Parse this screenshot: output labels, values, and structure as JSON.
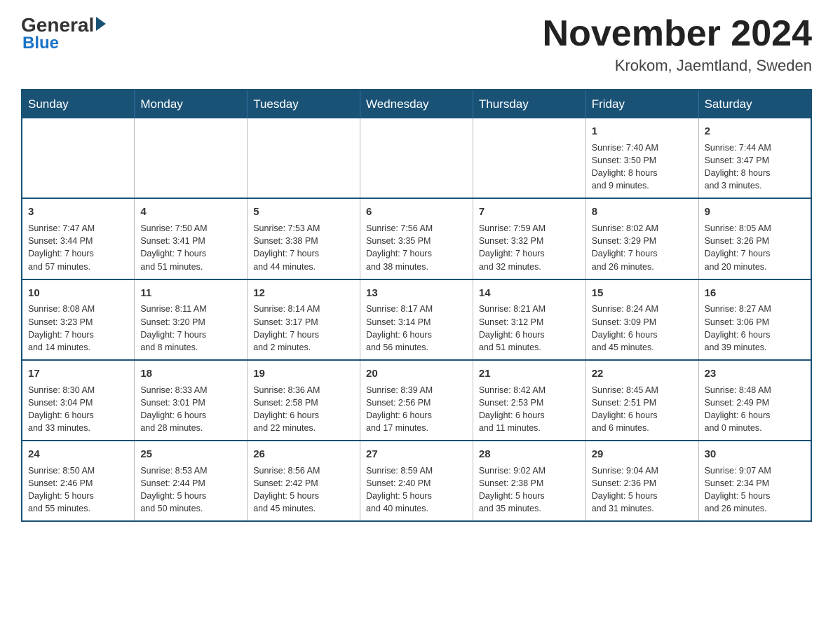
{
  "header": {
    "logo_general": "General",
    "logo_blue": "Blue",
    "month_title": "November 2024",
    "location": "Krokom, Jaemtland, Sweden"
  },
  "days_of_week": [
    "Sunday",
    "Monday",
    "Tuesday",
    "Wednesday",
    "Thursday",
    "Friday",
    "Saturday"
  ],
  "weeks": [
    [
      {
        "day": "",
        "info": ""
      },
      {
        "day": "",
        "info": ""
      },
      {
        "day": "",
        "info": ""
      },
      {
        "day": "",
        "info": ""
      },
      {
        "day": "",
        "info": ""
      },
      {
        "day": "1",
        "info": "Sunrise: 7:40 AM\nSunset: 3:50 PM\nDaylight: 8 hours\nand 9 minutes."
      },
      {
        "day": "2",
        "info": "Sunrise: 7:44 AM\nSunset: 3:47 PM\nDaylight: 8 hours\nand 3 minutes."
      }
    ],
    [
      {
        "day": "3",
        "info": "Sunrise: 7:47 AM\nSunset: 3:44 PM\nDaylight: 7 hours\nand 57 minutes."
      },
      {
        "day": "4",
        "info": "Sunrise: 7:50 AM\nSunset: 3:41 PM\nDaylight: 7 hours\nand 51 minutes."
      },
      {
        "day": "5",
        "info": "Sunrise: 7:53 AM\nSunset: 3:38 PM\nDaylight: 7 hours\nand 44 minutes."
      },
      {
        "day": "6",
        "info": "Sunrise: 7:56 AM\nSunset: 3:35 PM\nDaylight: 7 hours\nand 38 minutes."
      },
      {
        "day": "7",
        "info": "Sunrise: 7:59 AM\nSunset: 3:32 PM\nDaylight: 7 hours\nand 32 minutes."
      },
      {
        "day": "8",
        "info": "Sunrise: 8:02 AM\nSunset: 3:29 PM\nDaylight: 7 hours\nand 26 minutes."
      },
      {
        "day": "9",
        "info": "Sunrise: 8:05 AM\nSunset: 3:26 PM\nDaylight: 7 hours\nand 20 minutes."
      }
    ],
    [
      {
        "day": "10",
        "info": "Sunrise: 8:08 AM\nSunset: 3:23 PM\nDaylight: 7 hours\nand 14 minutes."
      },
      {
        "day": "11",
        "info": "Sunrise: 8:11 AM\nSunset: 3:20 PM\nDaylight: 7 hours\nand 8 minutes."
      },
      {
        "day": "12",
        "info": "Sunrise: 8:14 AM\nSunset: 3:17 PM\nDaylight: 7 hours\nand 2 minutes."
      },
      {
        "day": "13",
        "info": "Sunrise: 8:17 AM\nSunset: 3:14 PM\nDaylight: 6 hours\nand 56 minutes."
      },
      {
        "day": "14",
        "info": "Sunrise: 8:21 AM\nSunset: 3:12 PM\nDaylight: 6 hours\nand 51 minutes."
      },
      {
        "day": "15",
        "info": "Sunrise: 8:24 AM\nSunset: 3:09 PM\nDaylight: 6 hours\nand 45 minutes."
      },
      {
        "day": "16",
        "info": "Sunrise: 8:27 AM\nSunset: 3:06 PM\nDaylight: 6 hours\nand 39 minutes."
      }
    ],
    [
      {
        "day": "17",
        "info": "Sunrise: 8:30 AM\nSunset: 3:04 PM\nDaylight: 6 hours\nand 33 minutes."
      },
      {
        "day": "18",
        "info": "Sunrise: 8:33 AM\nSunset: 3:01 PM\nDaylight: 6 hours\nand 28 minutes."
      },
      {
        "day": "19",
        "info": "Sunrise: 8:36 AM\nSunset: 2:58 PM\nDaylight: 6 hours\nand 22 minutes."
      },
      {
        "day": "20",
        "info": "Sunrise: 8:39 AM\nSunset: 2:56 PM\nDaylight: 6 hours\nand 17 minutes."
      },
      {
        "day": "21",
        "info": "Sunrise: 8:42 AM\nSunset: 2:53 PM\nDaylight: 6 hours\nand 11 minutes."
      },
      {
        "day": "22",
        "info": "Sunrise: 8:45 AM\nSunset: 2:51 PM\nDaylight: 6 hours\nand 6 minutes."
      },
      {
        "day": "23",
        "info": "Sunrise: 8:48 AM\nSunset: 2:49 PM\nDaylight: 6 hours\nand 0 minutes."
      }
    ],
    [
      {
        "day": "24",
        "info": "Sunrise: 8:50 AM\nSunset: 2:46 PM\nDaylight: 5 hours\nand 55 minutes."
      },
      {
        "day": "25",
        "info": "Sunrise: 8:53 AM\nSunset: 2:44 PM\nDaylight: 5 hours\nand 50 minutes."
      },
      {
        "day": "26",
        "info": "Sunrise: 8:56 AM\nSunset: 2:42 PM\nDaylight: 5 hours\nand 45 minutes."
      },
      {
        "day": "27",
        "info": "Sunrise: 8:59 AM\nSunset: 2:40 PM\nDaylight: 5 hours\nand 40 minutes."
      },
      {
        "day": "28",
        "info": "Sunrise: 9:02 AM\nSunset: 2:38 PM\nDaylight: 5 hours\nand 35 minutes."
      },
      {
        "day": "29",
        "info": "Sunrise: 9:04 AM\nSunset: 2:36 PM\nDaylight: 5 hours\nand 31 minutes."
      },
      {
        "day": "30",
        "info": "Sunrise: 9:07 AM\nSunset: 2:34 PM\nDaylight: 5 hours\nand 26 minutes."
      }
    ]
  ]
}
